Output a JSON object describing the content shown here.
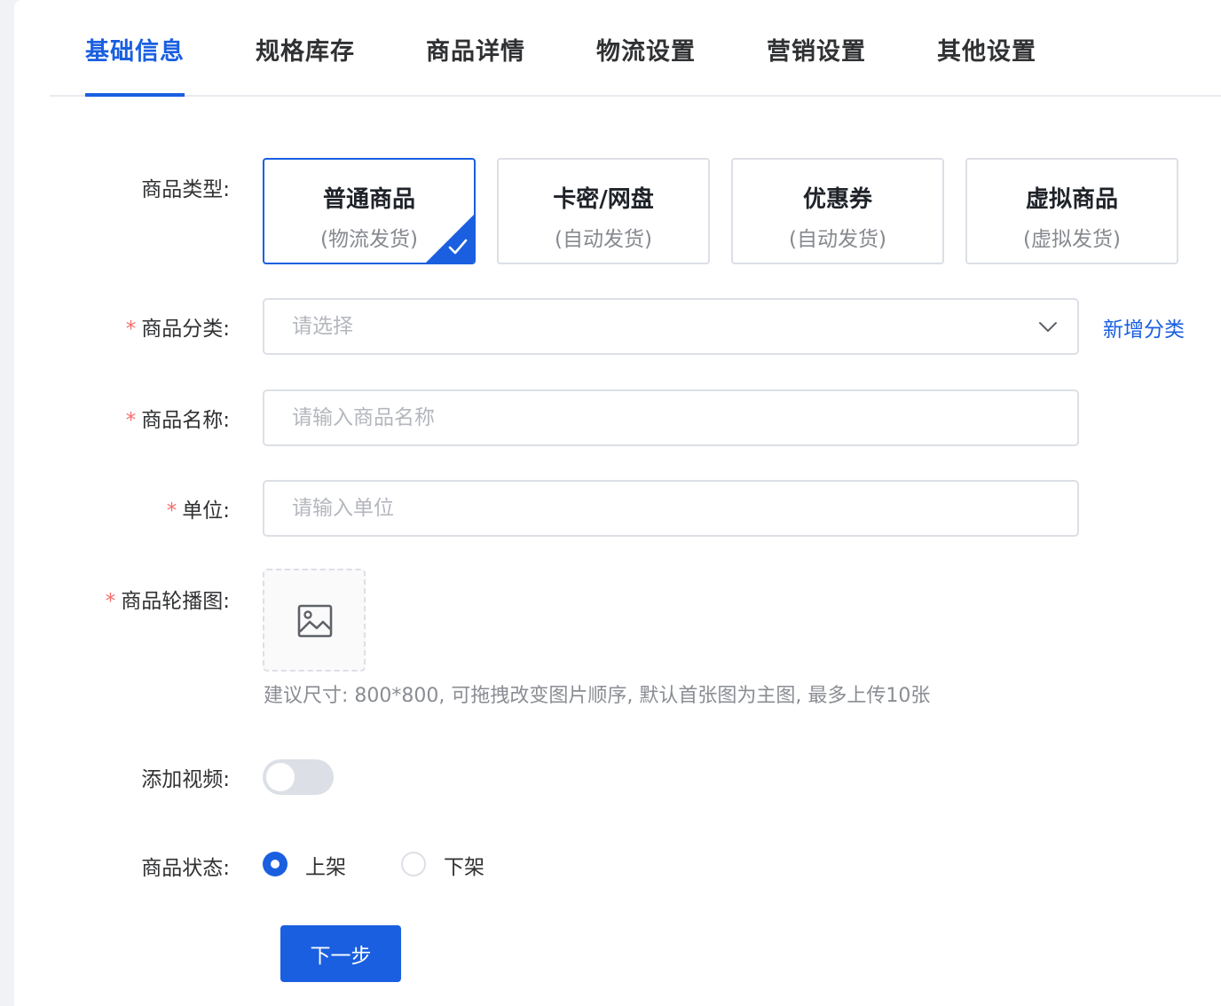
{
  "tabs": [
    {
      "label": "基础信息",
      "active": true
    },
    {
      "label": "规格库存"
    },
    {
      "label": "商品详情"
    },
    {
      "label": "物流设置"
    },
    {
      "label": "营销设置"
    },
    {
      "label": "其他设置"
    }
  ],
  "form": {
    "product_type": {
      "label": "商品类型:",
      "options": [
        {
          "title": "普通商品",
          "sub": "(物流发货)",
          "selected": true
        },
        {
          "title": "卡密/网盘",
          "sub": "(自动发货)"
        },
        {
          "title": "优惠券",
          "sub": "(自动发货)"
        },
        {
          "title": "虚拟商品",
          "sub": "(虚拟发货)"
        }
      ]
    },
    "category": {
      "label": "商品分类:",
      "required_mark": "*",
      "placeholder": "请选择",
      "add_link": "新增分类"
    },
    "name": {
      "label": "商品名称:",
      "required_mark": "*",
      "placeholder": "请输入商品名称"
    },
    "unit": {
      "label": "单位:",
      "required_mark": "*",
      "placeholder": "请输入单位"
    },
    "carousel": {
      "label": "商品轮播图:",
      "required_mark": "*",
      "hint": "建议尺寸: 800*800, 可拖拽改变图片顺序, 默认首张图为主图, 最多上传10张"
    },
    "video": {
      "label": "添加视频:",
      "enabled": false
    },
    "status": {
      "label": "商品状态:",
      "options": [
        {
          "label": "上架",
          "checked": true
        },
        {
          "label": "下架",
          "checked": false
        }
      ]
    },
    "next_button": "下一步"
  },
  "colors": {
    "primary": "#1a5fe0",
    "required": "#f56c6c",
    "border": "#dcdfe6",
    "placeholder": "#b4b7bd",
    "hint": "#8a8d93"
  }
}
